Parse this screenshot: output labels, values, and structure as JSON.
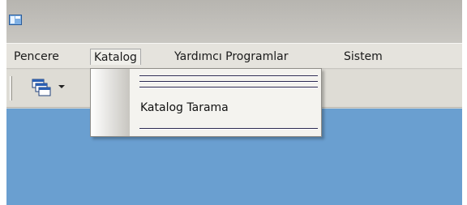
{
  "menubar": {
    "items": [
      {
        "label": "Pencere"
      },
      {
        "label": "Katalog"
      },
      {
        "label": "Yardımcı Programlar"
      },
      {
        "label": "Sistem"
      }
    ]
  },
  "dropdown": {
    "parent": "Katalog",
    "items": [
      {
        "label": "Katalog Tarama"
      }
    ]
  },
  "toolbar": {
    "buttons": [
      {
        "icon": "cascade-windows-icon",
        "has_dropdown": true
      }
    ]
  },
  "colors": {
    "workspace": "#6a9fd0",
    "menubar": "#e5e3dd",
    "separator": "#2c2a52"
  }
}
